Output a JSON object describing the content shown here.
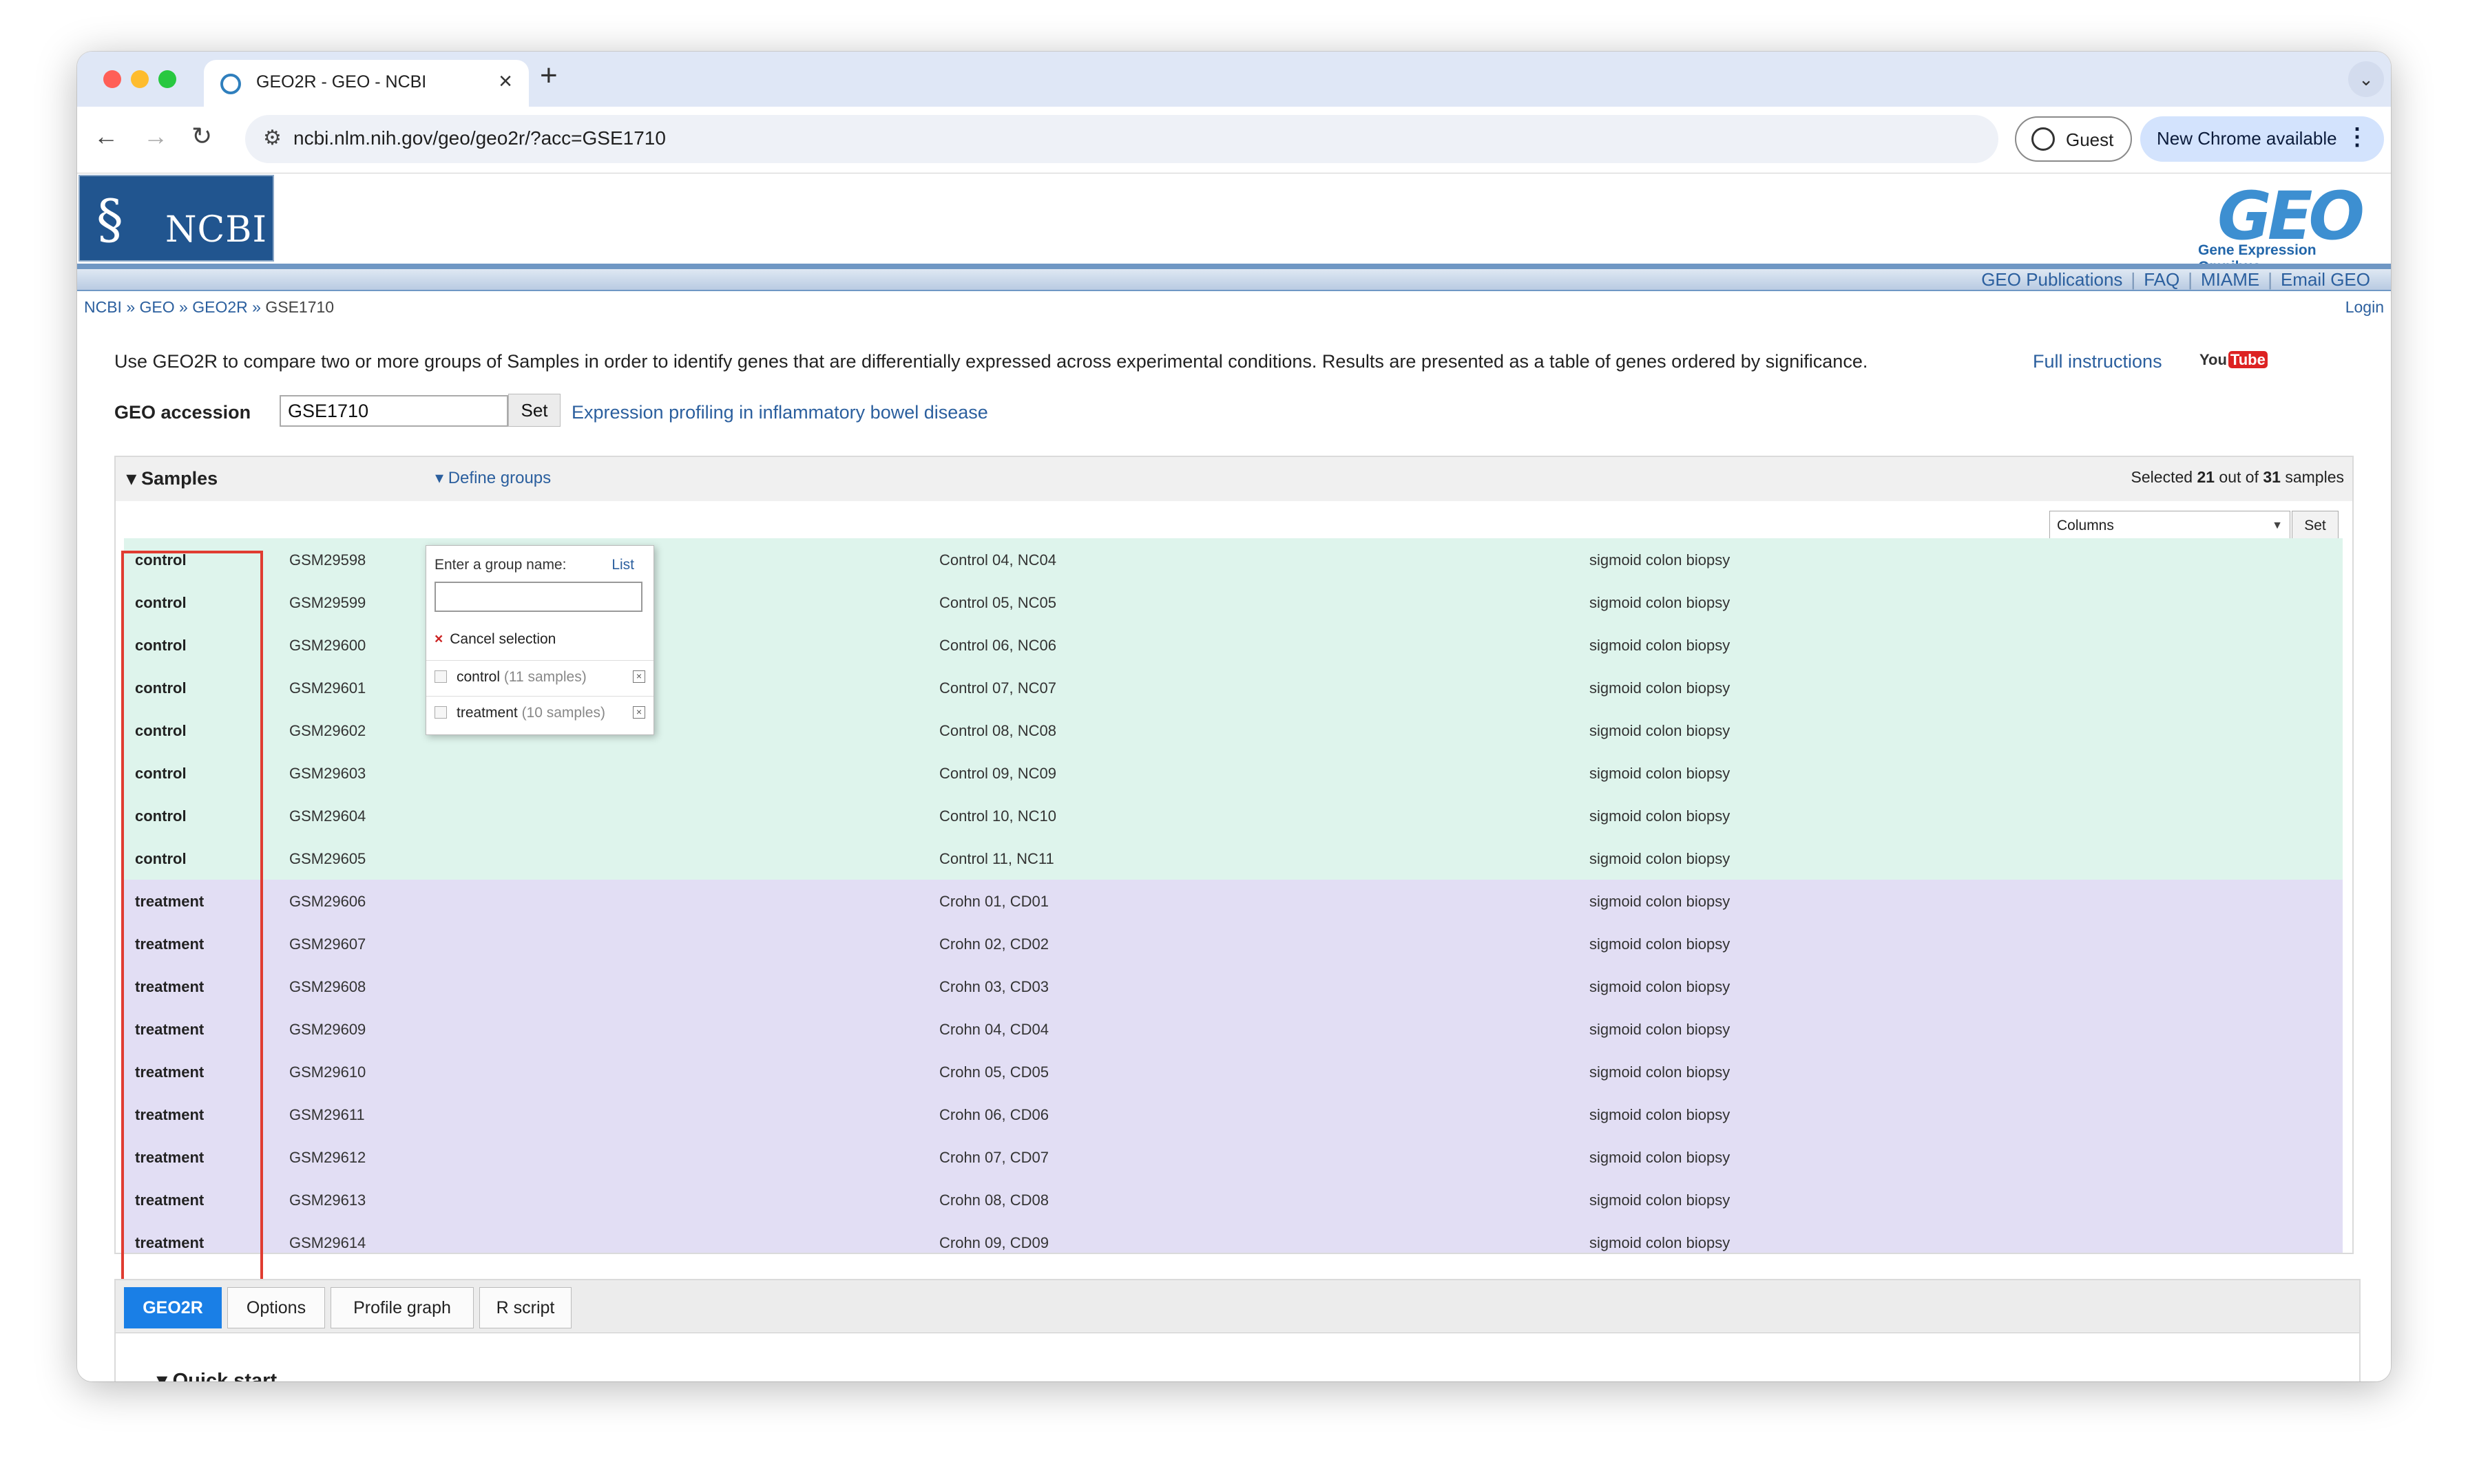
{
  "browser": {
    "tab_title": "GEO2R - GEO - NCBI",
    "close_glyph": "×",
    "newtab_glyph": "+",
    "tabmenu_glyph": "⌄",
    "url": "ncbi.nlm.nih.gov/geo/geo2r/?acc=GSE1710",
    "guest_label": "Guest",
    "update_label": "New Chrome available",
    "dots_glyph": "⋮",
    "traffic_colors": [
      "#ff5f57",
      "#febc2e",
      "#28c840"
    ]
  },
  "header": {
    "ncbi_logo_text": "NCBI",
    "geo_logo_text": "GEO",
    "geo_logo_sub": "Gene Expression Omnibus",
    "links": [
      "GEO Publications",
      "FAQ",
      "MIAME",
      "Email GEO"
    ]
  },
  "breadcrumb": {
    "items": [
      "NCBI",
      "GEO",
      "GEO2R",
      "GSE1710"
    ],
    "sep": "»",
    "login": "Login"
  },
  "intro": {
    "text": "Use GEO2R to compare two or more groups of Samples in order to identify genes that are differentially expressed across experimental conditions. Results are presented as a table of genes ordered by significance.",
    "full_instructions": "Full instructions",
    "youtube_you": "You",
    "youtube_tube": "Tube"
  },
  "accession": {
    "label": "GEO accession",
    "value": "GSE1710",
    "set_label": "Set",
    "title": "Expression profiling in inflammatory bowel disease"
  },
  "samples": {
    "title": "Samples",
    "define_groups": "Define groups",
    "selected_prefix": "Selected ",
    "selected_count": "21",
    "selected_mid": " out of ",
    "selected_total": "31",
    "selected_suffix": " samples",
    "columns_label": "Columns",
    "set_label": "Set",
    "rows": [
      {
        "group": "control",
        "gsm": "GSM29598",
        "title": "Control 04, NC04",
        "source": "sigmoid colon biopsy"
      },
      {
        "group": "control",
        "gsm": "GSM29599",
        "title": "Control 05, NC05",
        "source": "sigmoid colon biopsy"
      },
      {
        "group": "control",
        "gsm": "GSM29600",
        "title": "Control 06, NC06",
        "source": "sigmoid colon biopsy"
      },
      {
        "group": "control",
        "gsm": "GSM29601",
        "title": "Control 07, NC07",
        "source": "sigmoid colon biopsy"
      },
      {
        "group": "control",
        "gsm": "GSM29602",
        "title": "Control 08, NC08",
        "source": "sigmoid colon biopsy"
      },
      {
        "group": "control",
        "gsm": "GSM29603",
        "title": "Control 09, NC09",
        "source": "sigmoid colon biopsy"
      },
      {
        "group": "control",
        "gsm": "GSM29604",
        "title": "Control 10, NC10",
        "source": "sigmoid colon biopsy"
      },
      {
        "group": "control",
        "gsm": "GSM29605",
        "title": "Control 11, NC11",
        "source": "sigmoid colon biopsy"
      },
      {
        "group": "treatment",
        "gsm": "GSM29606",
        "title": "Crohn 01, CD01",
        "source": "sigmoid colon biopsy"
      },
      {
        "group": "treatment",
        "gsm": "GSM29607",
        "title": "Crohn 02, CD02",
        "source": "sigmoid colon biopsy"
      },
      {
        "group": "treatment",
        "gsm": "GSM29608",
        "title": "Crohn 03, CD03",
        "source": "sigmoid colon biopsy"
      },
      {
        "group": "treatment",
        "gsm": "GSM29609",
        "title": "Crohn 04, CD04",
        "source": "sigmoid colon biopsy"
      },
      {
        "group": "treatment",
        "gsm": "GSM29610",
        "title": "Crohn 05, CD05",
        "source": "sigmoid colon biopsy"
      },
      {
        "group": "treatment",
        "gsm": "GSM29611",
        "title": "Crohn 06, CD06",
        "source": "sigmoid colon biopsy"
      },
      {
        "group": "treatment",
        "gsm": "GSM29612",
        "title": "Crohn 07, CD07",
        "source": "sigmoid colon biopsy"
      },
      {
        "group": "treatment",
        "gsm": "GSM29613",
        "title": "Crohn 08, CD08",
        "source": "sigmoid colon biopsy"
      },
      {
        "group": "treatment",
        "gsm": "GSM29614",
        "title": "Crohn 09, CD09",
        "source": "sigmoid colon biopsy"
      }
    ]
  },
  "popup": {
    "enter_label": "Enter a group name:",
    "list_label": "List",
    "name_value": "",
    "cancel_label": "Cancel selection",
    "cancel_glyph": "×",
    "del_glyph": "×",
    "groups": [
      {
        "name": "control",
        "count": "(11 samples)"
      },
      {
        "name": "treatment",
        "count": "(10 samples)"
      }
    ]
  },
  "bottom_tabs": {
    "tabs": [
      "GEO2R",
      "Options",
      "Profile graph",
      "R script"
    ],
    "active": "GEO2R",
    "quick_start": "Quick start"
  },
  "colors": {
    "control_row": "#def4ec",
    "treatment_row": "#e2def4",
    "annotation_box": "#e03c31",
    "active_tab": "#1a7fe6",
    "link": "#2b5f9e"
  }
}
